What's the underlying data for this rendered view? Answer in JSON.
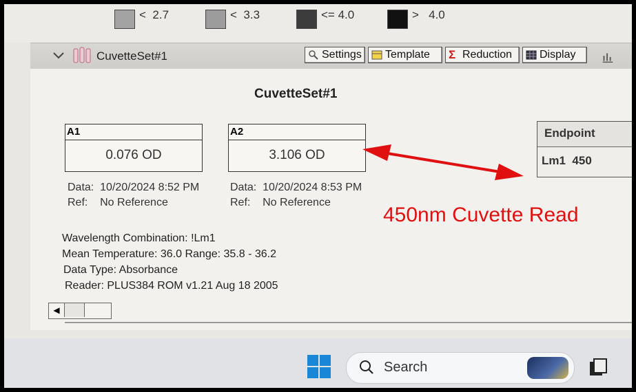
{
  "legend": [
    {
      "symbol": "<",
      "value": "2.7",
      "color": "#a3a3a3"
    },
    {
      "symbol": "<",
      "value": "3.3",
      "color": "#9c9c9c"
    },
    {
      "symbol": "<=",
      "value": "4.0",
      "color": "#3c3c3c"
    },
    {
      "symbol": ">",
      "value": "4.0",
      "color": "#111111"
    }
  ],
  "header": {
    "title": "CuvetteSet#1",
    "buttons": {
      "settings": "Settings",
      "template": "Template",
      "reduction": "Reduction",
      "display": "Display"
    }
  },
  "content": {
    "title": "CuvetteSet#1",
    "wells": [
      {
        "id": "A1",
        "value": "0.076 OD",
        "data_label": "Data:",
        "data_value": "10/20/2024  8:52 PM",
        "ref_label": "Ref:",
        "ref_value": "No Reference"
      },
      {
        "id": "A2",
        "value": "3.106 OD",
        "data_label": "Data:",
        "data_value": "10/20/2024  8:53 PM",
        "ref_label": "Ref:",
        "ref_value": "No Reference"
      }
    ],
    "endpoint": {
      "header": "Endpoint",
      "label": "Lm1",
      "wavelength": "450"
    },
    "info": {
      "wavelength_combination": "Wavelength Combination: !Lm1",
      "mean_temperature": "Mean Temperature: 36.0  Range: 35.8 - 36.2",
      "data_type": "Data Type: Absorbance",
      "reader": "Reader: PLUS384 ROM v1.21 Aug 18 2005"
    },
    "annotation": "450nm Cuvette Read",
    "annotation_color": "#e01010"
  },
  "taskbar": {
    "search_text": "Search"
  }
}
